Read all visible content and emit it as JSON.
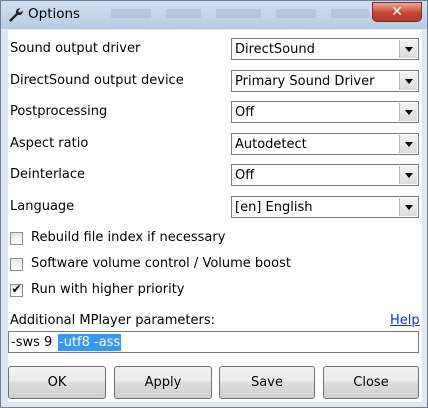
{
  "window": {
    "title": "Options",
    "icon": "wrench-icon",
    "close_icon": "close-x-icon"
  },
  "settings": [
    {
      "label": "Sound output driver",
      "value": "DirectSound"
    },
    {
      "label": "DirectSound output device",
      "value": "Primary Sound Driver"
    },
    {
      "label": "Postprocessing",
      "value": "Off"
    },
    {
      "label": "Aspect ratio",
      "value": "Autodetect"
    },
    {
      "label": "Deinterlace",
      "value": "Off"
    },
    {
      "label": "Language",
      "value": "[en] English"
    }
  ],
  "checkboxes": [
    {
      "label": "Rebuild file index if necessary",
      "checked": false
    },
    {
      "label": "Software volume control / Volume boost",
      "checked": false
    },
    {
      "label": "Run with higher priority",
      "checked": true
    }
  ],
  "params": {
    "label": "Additional MPlayer parameters:",
    "help": "Help",
    "value_plain": "-sws 9 ",
    "value_selected": "-utf8 -ass"
  },
  "buttons": {
    "ok": "OK",
    "apply": "Apply",
    "save": "Save",
    "close": "Close"
  },
  "colors": {
    "selection": "#3399ff",
    "link": "#0b2ee0",
    "close_button": "#c6452f"
  }
}
